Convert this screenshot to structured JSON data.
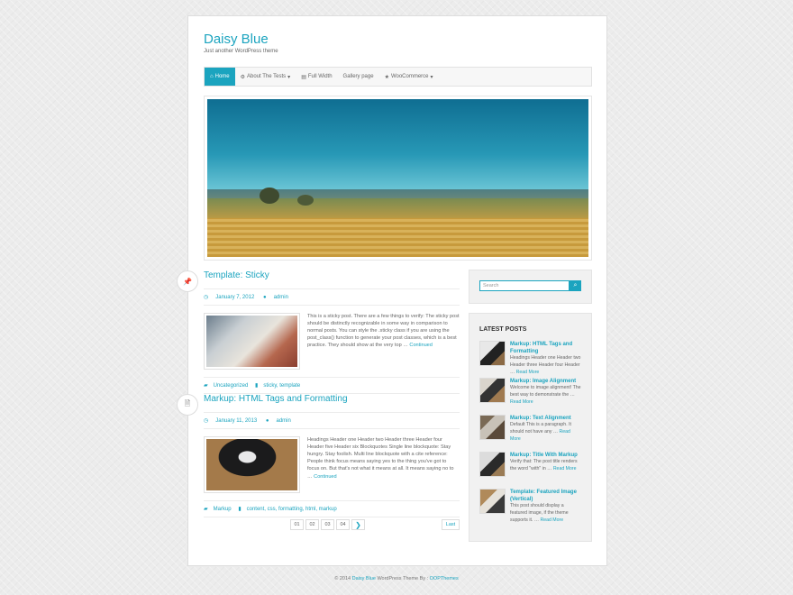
{
  "site": {
    "title": "Daisy Blue",
    "description": "Just another WordPress theme"
  },
  "nav": {
    "items": [
      {
        "label": "Home",
        "icon": "home-icon"
      },
      {
        "label": "About The Tests",
        "icon": "gear-icon",
        "caret": "▾"
      },
      {
        "label": "Full Width",
        "icon": "document-icon"
      },
      {
        "label": "Gallery page"
      },
      {
        "label": "WooCommerce",
        "icon": "star-icon",
        "caret": "▾"
      }
    ]
  },
  "posts": [
    {
      "title": "Template: Sticky",
      "marker_icon": "pin-icon",
      "date": "January 7, 2012",
      "author": "admin",
      "excerpt": "This is a sticky post. There are a few things to verify: The sticky post should be distinctly recognizable in some way in comparison to normal posts. You can style the .sticky class if you are using the post_class() function to generate your post classes, which is a best practice. They should show at the very top …",
      "more": "Continued",
      "category": "Uncategorized",
      "tags": "sticky, template"
    },
    {
      "title": "Markup: HTML Tags and Formatting",
      "marker_icon": "document-icon",
      "date": "January 11, 2013",
      "author": "admin",
      "excerpt": "Headings Header one Header two Header three Header four Header five Header six Blockquotes Single line blockquote: Stay hungry. Stay foolish. Multi line blockquote with a cite reference: People think focus means saying yes to the thing you've got to focus on. But that's not what it means at all. It means saying no to …",
      "more": "Continued",
      "category": "Markup",
      "tags": "content, css, formatting, html, markup"
    }
  ],
  "pagination": {
    "pages": [
      "01",
      "02",
      "03",
      "04"
    ],
    "next": "❯",
    "last": "Last"
  },
  "sidebar": {
    "search_placeholder": "Search",
    "latest_heading": "LATEST POSTS",
    "latest": [
      {
        "title": "Markup: HTML Tags and Formatting",
        "text": "Headings Header one Header two Header three Header four Header …",
        "more": "Read More"
      },
      {
        "title": "Markup: Image Alignment",
        "text": "Welcome to image alignment! The best way to demonstrate the …",
        "more": "Read More"
      },
      {
        "title": "Markup: Text Alignment",
        "text": "Default This is a paragraph. It should not have any …",
        "more": "Read More"
      },
      {
        "title": "Markup: Title With Markup",
        "text": "Verify that: The post title renders the word \"with\" in …",
        "more": "Read More"
      },
      {
        "title": "Template: Featured Image (Vertical)",
        "text": "This post should display a featured image, if the theme supports it. …",
        "more": "Read More"
      }
    ]
  },
  "footer": {
    "prefix": "© 2014",
    "theme": "Daisy Blue",
    "middle": "WordPress Theme By :",
    "author": "OOPThemes"
  },
  "colors": {
    "accent": "#1ba4bf",
    "background": "#ececec"
  }
}
